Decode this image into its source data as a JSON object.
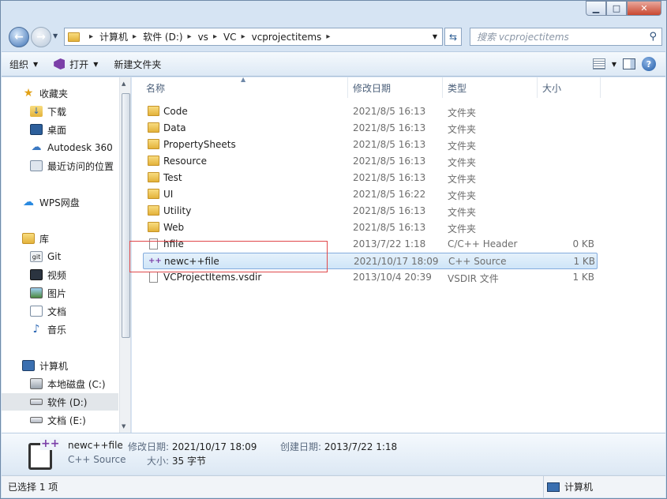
{
  "window": {
    "minimize": "▁",
    "maximize": "□",
    "close": "✕"
  },
  "address": {
    "segments": [
      "计算机",
      "软件 (D:)",
      "vs",
      "VC",
      "vcprojectitems"
    ],
    "search_placeholder": "搜索 vcprojectitems"
  },
  "toolbar": {
    "organize": "组织",
    "open": "打开",
    "new_folder": "新建文件夹"
  },
  "nav": {
    "items": [
      {
        "label": "收藏夹",
        "icon": "star-icon"
      },
      {
        "label": "下载",
        "icon": "download-folder-icon"
      },
      {
        "label": "桌面",
        "icon": "desktop-icon"
      },
      {
        "label": "Autodesk 360",
        "icon": "cloud-icon"
      },
      {
        "label": "最近访问的位置",
        "icon": "recent-places-icon"
      },
      {
        "label": "WPS网盘",
        "icon": "wps-cloud-icon"
      },
      {
        "label": "库",
        "icon": "library-icon"
      },
      {
        "label": "Git",
        "icon": "git-icon"
      },
      {
        "label": "视频",
        "icon": "video-icon"
      },
      {
        "label": "图片",
        "icon": "picture-icon"
      },
      {
        "label": "文档",
        "icon": "document-icon"
      },
      {
        "label": "音乐",
        "icon": "music-icon"
      },
      {
        "label": "计算机",
        "icon": "computer-icon"
      },
      {
        "label": "本地磁盘 (C:)",
        "icon": "drive-c-icon"
      },
      {
        "label": "软件 (D:)",
        "icon": "drive-icon"
      },
      {
        "label": "文档 (E:)",
        "icon": "drive-icon"
      }
    ]
  },
  "columns": {
    "name": "名称",
    "date": "修改日期",
    "type": "类型",
    "size": "大小"
  },
  "files": [
    {
      "name": "Code",
      "date": "2021/8/5 16:13",
      "type": "文件夹",
      "size": ""
    },
    {
      "name": "Data",
      "date": "2021/8/5 16:13",
      "type": "文件夹",
      "size": ""
    },
    {
      "name": "PropertySheets",
      "date": "2021/8/5 16:13",
      "type": "文件夹",
      "size": ""
    },
    {
      "name": "Resource",
      "date": "2021/8/5 16:13",
      "type": "文件夹",
      "size": ""
    },
    {
      "name": "Test",
      "date": "2021/8/5 16:13",
      "type": "文件夹",
      "size": ""
    },
    {
      "name": "UI",
      "date": "2021/8/5 16:22",
      "type": "文件夹",
      "size": ""
    },
    {
      "name": "Utility",
      "date": "2021/8/5 16:13",
      "type": "文件夹",
      "size": ""
    },
    {
      "name": "Web",
      "date": "2021/8/5 16:13",
      "type": "文件夹",
      "size": ""
    },
    {
      "name": "hfile",
      "date": "2013/7/22 1:18",
      "type": "C/C++ Header",
      "size": "0 KB"
    },
    {
      "name": "newc++file",
      "date": "2021/10/17 18:09",
      "type": "C++ Source",
      "size": "1 KB"
    },
    {
      "name": "VCProjectItems.vsdir",
      "date": "2013/10/4 20:39",
      "type": "VSDIR 文件",
      "size": "1 KB"
    }
  ],
  "details": {
    "name": "newc++file",
    "type": "C++ Source",
    "modified_label": "修改日期:",
    "modified": "2021/10/17 18:09",
    "created_label": "创建日期:",
    "created": "2013/7/22 1:18",
    "size_label": "大小:",
    "size": "35 字节"
  },
  "status": {
    "selection": "已选择 1 项",
    "location": "计算机"
  },
  "colors": {
    "accent": "#3c70b3",
    "selection": "#cfe5f8",
    "highlight_box": "#e0484a"
  }
}
